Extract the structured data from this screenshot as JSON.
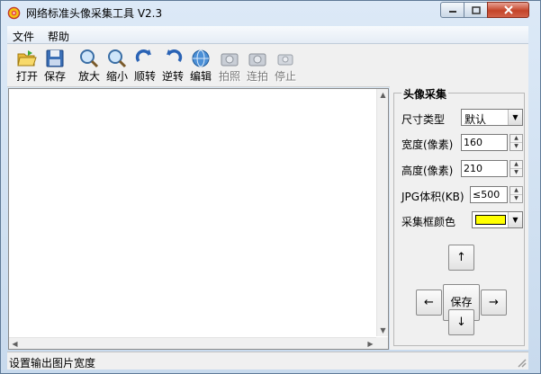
{
  "window": {
    "title": "网络标准头像采集工具 V2.3"
  },
  "menu": {
    "items": [
      "文件",
      "帮助"
    ]
  },
  "toolbar": {
    "buttons": [
      {
        "label": "打开",
        "icon": "open-folder-icon"
      },
      {
        "label": "保存",
        "icon": "save-disk-icon"
      },
      {
        "label": "放大",
        "icon": "zoom-in-icon"
      },
      {
        "label": "缩小",
        "icon": "zoom-out-icon"
      },
      {
        "label": "顺转",
        "icon": "rotate-clockwise-icon"
      },
      {
        "label": "逆转",
        "icon": "rotate-counterclockwise-icon"
      },
      {
        "label": "编辑",
        "icon": "edit-globe-icon"
      },
      {
        "label": "拍照",
        "icon": "camera-icon"
      },
      {
        "label": "连拍",
        "icon": "burst-camera-icon"
      },
      {
        "label": "停止",
        "icon": "stop-camera-icon"
      }
    ]
  },
  "panel": {
    "group_title": "头像采集",
    "size_type": {
      "label": "尺寸类型",
      "value": "默认"
    },
    "width": {
      "label": "宽度(像素)",
      "value": "160"
    },
    "height": {
      "label": "高度(像素)",
      "value": "210"
    },
    "jpg_size": {
      "label": "JPG体积(KB)",
      "value": "≤500"
    },
    "frame_color": {
      "label": "采集框颜色",
      "color": "#ffff00"
    },
    "nav": {
      "up": "↑",
      "down": "↓",
      "left": "←",
      "right": "→",
      "save": "保存"
    }
  },
  "status": {
    "text": "设置输出图片宽度"
  }
}
